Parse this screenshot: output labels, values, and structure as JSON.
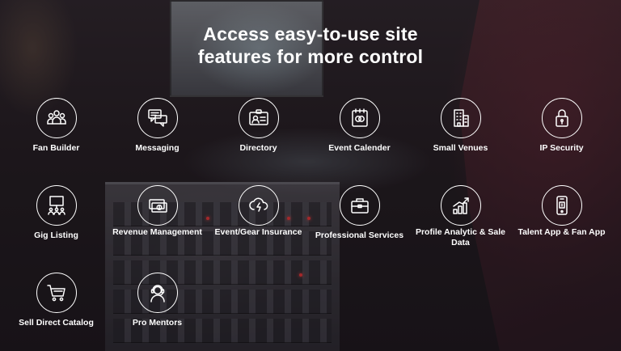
{
  "headline": {
    "line1": "Access easy-to-use site",
    "line2": "features for more control"
  },
  "features": [
    {
      "label": "Fan Builder",
      "icon": "group-icon"
    },
    {
      "label": "Messaging",
      "icon": "chat-bubbles-icon"
    },
    {
      "label": "Directory",
      "icon": "id-card-icon"
    },
    {
      "label": "Event Calender",
      "icon": "calendar-icon"
    },
    {
      "label": "Small Venues",
      "icon": "building-icon"
    },
    {
      "label": "IP Security",
      "icon": "lock-icon"
    },
    {
      "label": "Gig Listing",
      "icon": "presentation-board-icon"
    },
    {
      "label": "Revenue Management",
      "icon": "money-icon"
    },
    {
      "label": "Event/Gear Insurance",
      "icon": "cloud-shield-icon"
    },
    {
      "label": "Professional Services",
      "icon": "briefcase-icon"
    },
    {
      "label": "Profile Analytic & Sale Data",
      "icon": "growth-chart-icon"
    },
    {
      "label": "Talent App & Fan App",
      "icon": "smartphone-icon"
    },
    {
      "label": "Sell Direct Catalog",
      "icon": "shopping-cart-icon"
    },
    {
      "label": "Pro Mentors",
      "icon": "headset-person-icon"
    }
  ]
}
